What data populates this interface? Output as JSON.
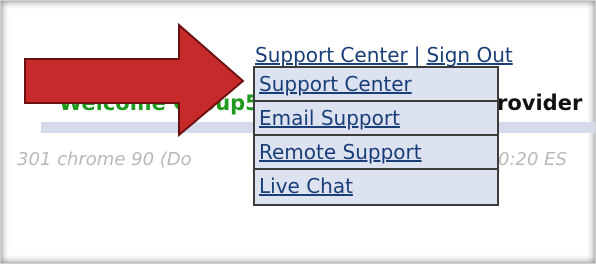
{
  "header": {
    "links": [
      {
        "label": "Support Center"
      },
      {
        "label": "Sign Out"
      }
    ],
    "separator": "|",
    "welcome_text": "Welcome Group5",
    "provider_text": "rovider"
  },
  "info_bar": {
    "browser_text": "301 chrome 90 (Do",
    "time_text": "0:20 ES"
  },
  "support_menu": {
    "items": [
      {
        "label": "Support Center"
      },
      {
        "label": "Email Support"
      },
      {
        "label": "Remote Support"
      },
      {
        "label": "Live Chat"
      }
    ]
  },
  "colors": {
    "link": "#1a3f78",
    "welcome": "#1f9a1f",
    "menu_background": "#dde2f1",
    "arrow_fill": "#c62a2a",
    "arrow_stroke": "#6b1010"
  }
}
